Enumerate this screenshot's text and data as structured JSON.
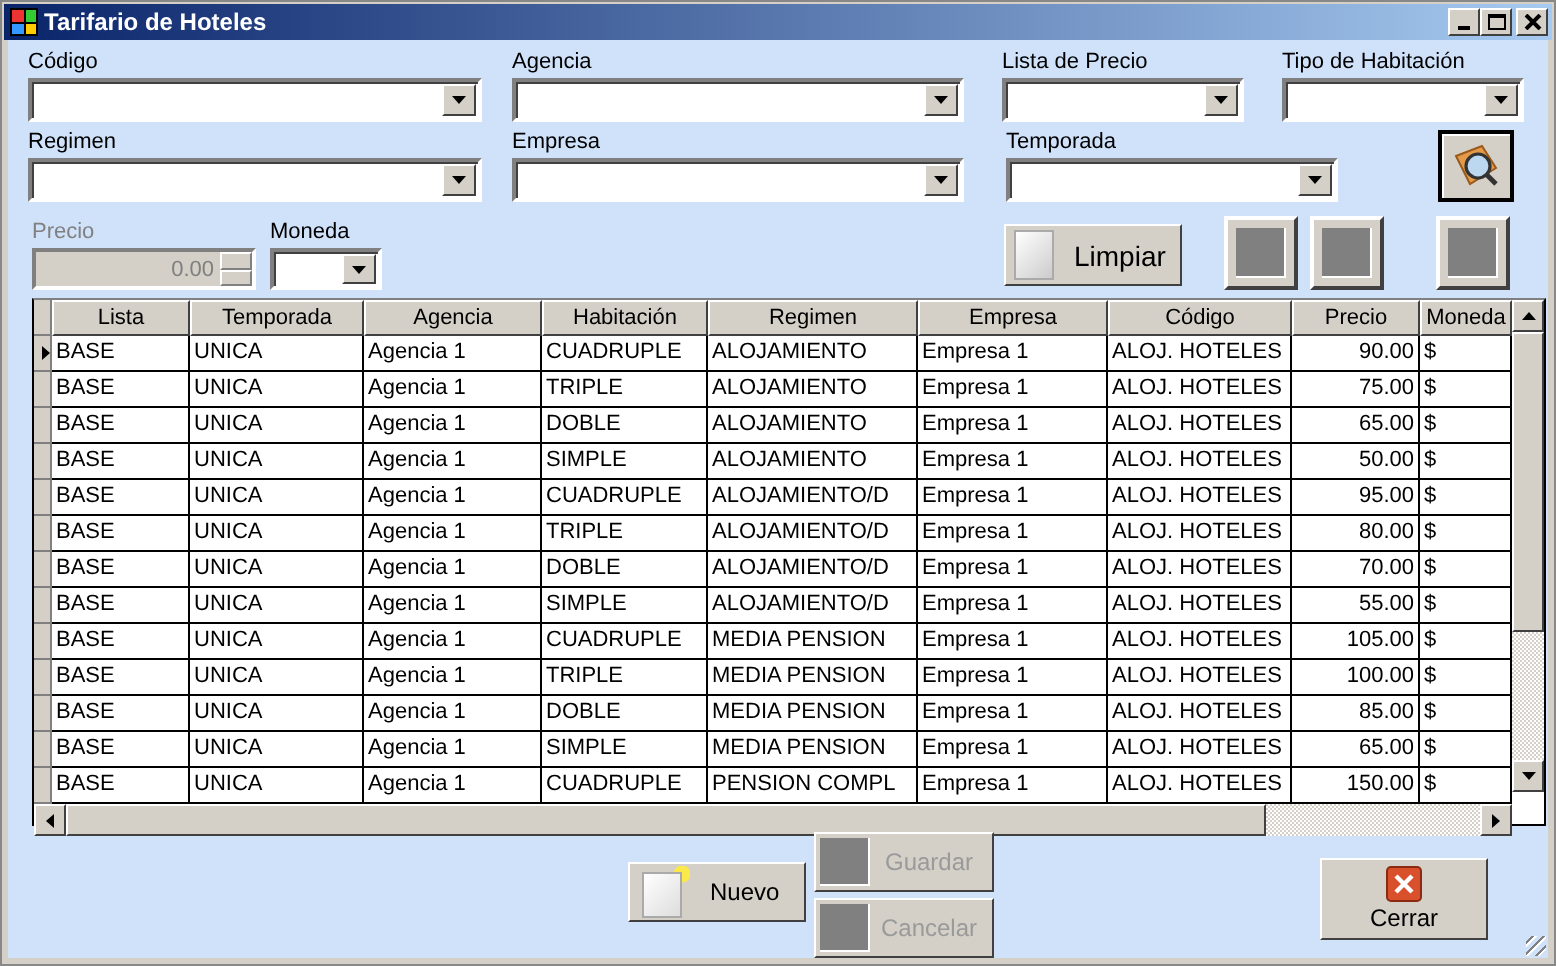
{
  "window": {
    "title": "Tarifario de Hoteles"
  },
  "filter_rows": [
    [
      {
        "label": "Código",
        "kind": "combo"
      },
      {
        "label": "Agencia",
        "kind": "combo"
      },
      {
        "label": "Lista de Precio",
        "kind": "combo"
      },
      {
        "label": "Tipo de Habitación",
        "kind": "combo"
      }
    ],
    [
      {
        "label": "Regimen",
        "kind": "combo"
      },
      {
        "label": "Empresa",
        "kind": "combo"
      },
      {
        "label": "Temporada",
        "kind": "combo"
      }
    ],
    [
      {
        "label": "Precio",
        "kind": "spin",
        "value": "0.00",
        "disabled": true
      },
      {
        "label": "Moneda",
        "kind": "combo"
      }
    ]
  ],
  "search_button": {
    "kind": "search"
  },
  "action_buttons": [
    {
      "kind": "clear",
      "label": "Limpiar"
    },
    {
      "kind": "blank"
    },
    {
      "kind": "blank"
    },
    {
      "kind": "blank"
    }
  ],
  "table": {
    "columns": [
      {
        "label": "Lista"
      },
      {
        "label": "Temporada"
      },
      {
        "label": "Agencia"
      },
      {
        "label": "Habitación"
      },
      {
        "label": "Regimen"
      },
      {
        "label": "Empresa"
      },
      {
        "label": "Código"
      },
      {
        "label": "Precio",
        "kind": "number"
      },
      {
        "label": "Moneda"
      }
    ],
    "rows": [
      {
        "selected": true,
        "cells": [
          "BASE",
          "UNICA",
          "Agencia 1",
          "CUADRUPLE",
          "ALOJAMIENTO",
          "Empresa 1",
          "ALOJ. HOTELES",
          "90.00",
          "$"
        ]
      },
      {
        "selected": false,
        "cells": [
          "BASE",
          "UNICA",
          "Agencia 1",
          "TRIPLE",
          "ALOJAMIENTO",
          "Empresa 1",
          "ALOJ. HOTELES",
          "75.00",
          "$"
        ]
      },
      {
        "selected": false,
        "cells": [
          "BASE",
          "UNICA",
          "Agencia 1",
          "DOBLE",
          "ALOJAMIENTO",
          "Empresa 1",
          "ALOJ. HOTELES",
          "65.00",
          "$"
        ]
      },
      {
        "selected": false,
        "cells": [
          "BASE",
          "UNICA",
          "Agencia 1",
          "SIMPLE",
          "ALOJAMIENTO",
          "Empresa 1",
          "ALOJ. HOTELES",
          "50.00",
          "$"
        ]
      },
      {
        "selected": false,
        "cells": [
          "BASE",
          "UNICA",
          "Agencia 1",
          "CUADRUPLE",
          "ALOJAMIENTO/D",
          "Empresa 1",
          "ALOJ. HOTELES",
          "95.00",
          "$"
        ]
      },
      {
        "selected": false,
        "cells": [
          "BASE",
          "UNICA",
          "Agencia 1",
          "TRIPLE",
          "ALOJAMIENTO/D",
          "Empresa 1",
          "ALOJ. HOTELES",
          "80.00",
          "$"
        ]
      },
      {
        "selected": false,
        "cells": [
          "BASE",
          "UNICA",
          "Agencia 1",
          "DOBLE",
          "ALOJAMIENTO/D",
          "Empresa 1",
          "ALOJ. HOTELES",
          "70.00",
          "$"
        ]
      },
      {
        "selected": false,
        "cells": [
          "BASE",
          "UNICA",
          "Agencia 1",
          "SIMPLE",
          "ALOJAMIENTO/D",
          "Empresa 1",
          "ALOJ. HOTELES",
          "55.00",
          "$"
        ]
      },
      {
        "selected": false,
        "cells": [
          "BASE",
          "UNICA",
          "Agencia 1",
          "CUADRUPLE",
          "MEDIA PENSION",
          "Empresa 1",
          "ALOJ. HOTELES",
          "105.00",
          "$"
        ]
      },
      {
        "selected": false,
        "cells": [
          "BASE",
          "UNICA",
          "Agencia 1",
          "TRIPLE",
          "MEDIA PENSION",
          "Empresa 1",
          "ALOJ. HOTELES",
          "100.00",
          "$"
        ]
      },
      {
        "selected": false,
        "cells": [
          "BASE",
          "UNICA",
          "Agencia 1",
          "DOBLE",
          "MEDIA PENSION",
          "Empresa 1",
          "ALOJ. HOTELES",
          "85.00",
          "$"
        ]
      },
      {
        "selected": false,
        "cells": [
          "BASE",
          "UNICA",
          "Agencia 1",
          "SIMPLE",
          "MEDIA PENSION",
          "Empresa 1",
          "ALOJ. HOTELES",
          "65.00",
          "$"
        ]
      },
      {
        "selected": false,
        "cells": [
          "BASE",
          "UNICA",
          "Agencia 1",
          "CUADRUPLE",
          "PENSION COMPL",
          "Empresa 1",
          "ALOJ. HOTELES",
          "150.00",
          "$"
        ]
      }
    ]
  },
  "bottom_buttons": [
    {
      "kind": "new",
      "label": "Nuevo",
      "disabled": false
    },
    {
      "kind": "blank",
      "label": "Guardar",
      "disabled": true
    },
    {
      "kind": "blank",
      "label": "Cancelar",
      "disabled": true
    },
    {
      "kind": "close",
      "label": "Cerrar",
      "disabled": false
    }
  ]
}
